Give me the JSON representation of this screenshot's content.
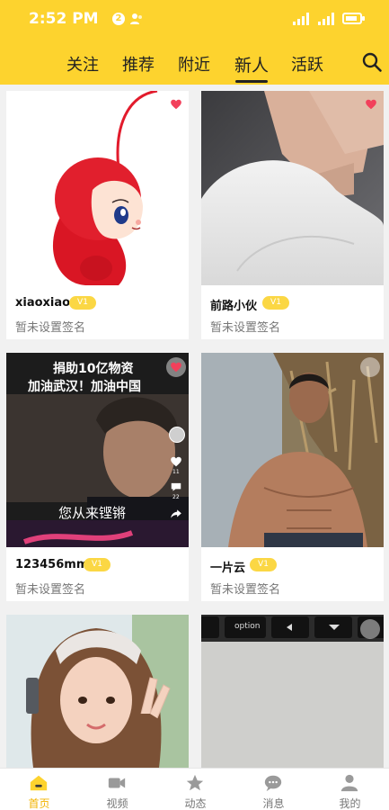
{
  "status_bar": {
    "time": "2:52 PM",
    "badge": "2"
  },
  "tabs": [
    {
      "label": "关注",
      "active": false
    },
    {
      "label": "推荐",
      "active": false
    },
    {
      "label": "附近",
      "active": false
    },
    {
      "label": "新人",
      "active": true
    },
    {
      "label": "活跃",
      "active": false
    }
  ],
  "cards": [
    {
      "name": "xiaoxiao",
      "level": "V1",
      "signature": "暂未设置签名",
      "image": "red-cartoon-character",
      "liked": true
    },
    {
      "name": "前路小伙",
      "level": "V1",
      "signature": "暂未设置签名",
      "image": "man-in-white-tshirt",
      "liked": true
    },
    {
      "name": "123456mm",
      "level": "V1",
      "signature": "暂未设置签名",
      "image": "video-frame-man",
      "liked": true,
      "overlay": {
        "top_line1": "捐助10亿物资",
        "top_line2": "加油武汉！加油中国",
        "subtitle": "您从来铿锵",
        "like_count": "11",
        "comment_count": "22"
      }
    },
    {
      "name": "一片云",
      "level": "V1",
      "signature": "暂未设置签名",
      "image": "shirtless-man-in-field",
      "liked": false
    },
    {
      "name": "",
      "level": "",
      "signature": "",
      "image": "girl-peace-sign",
      "liked": false
    },
    {
      "name": "",
      "level": "",
      "signature": "",
      "image": "keyboard-closeup",
      "liked": false,
      "keyboard": {
        "option_key": "option"
      }
    }
  ],
  "bottom_nav": [
    {
      "label": "首页",
      "icon": "home-icon",
      "active": true
    },
    {
      "label": "视频",
      "icon": "video-camera-icon",
      "active": false
    },
    {
      "label": "动态",
      "icon": "star-icon",
      "active": false
    },
    {
      "label": "消息",
      "icon": "chat-bubble-icon",
      "active": false
    },
    {
      "label": "我的",
      "icon": "person-icon",
      "active": false
    }
  ],
  "colors": {
    "brand": "#fdd32e",
    "active_nav": "#f2b300",
    "vip_badge": "#fbd744",
    "heart": "#f2405b"
  }
}
